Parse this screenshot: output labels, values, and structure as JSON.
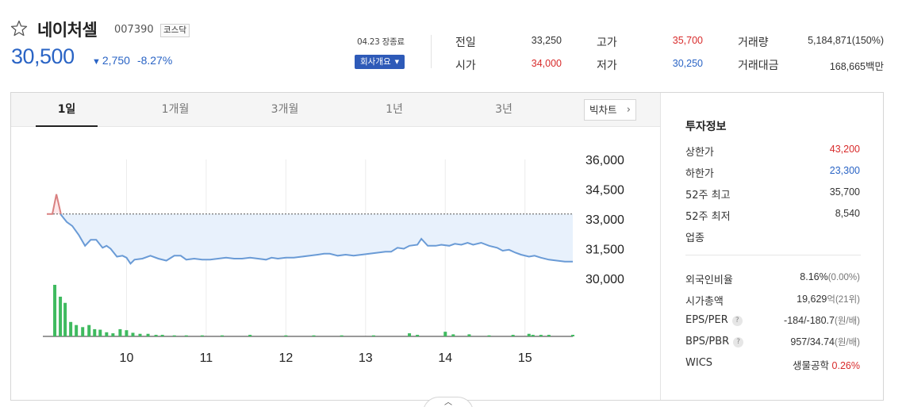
{
  "header": {
    "name": "네이처셀",
    "code": "007390",
    "market": "코스닥",
    "price": "30,500",
    "change_arrow": "▼",
    "change": "2,750",
    "rate": "-8.27%",
    "time_status": "04.23 장종료",
    "company_button": "회사개요"
  },
  "quote": {
    "prev_close": {
      "label": "전일",
      "value": "33,250"
    },
    "open": {
      "label": "시가",
      "value": "34,000"
    },
    "high": {
      "label": "고가",
      "value": "35,700"
    },
    "low": {
      "label": "저가",
      "value": "30,250"
    },
    "volume": {
      "label": "거래량",
      "value": "5,184,871(150%)"
    },
    "amount": {
      "label": "거래대금",
      "value": "168,665백만"
    }
  },
  "tabs": [
    "1일",
    "1개월",
    "3개월",
    "1년",
    "3년"
  ],
  "active_tab": "1일",
  "bigchart_label": "빅차트",
  "colors": {
    "up": "#d82b2b",
    "down": "#2a64c5",
    "volume": "#3fba5f",
    "line": "#6a9bd6"
  },
  "chart_data": {
    "type": "line",
    "y_ticks": [
      "36,000",
      "34,500",
      "33,000",
      "31,500",
      "30,000"
    ],
    "x_ticks": [
      "10",
      "11",
      "12",
      "13",
      "14",
      "15"
    ],
    "ylim": [
      30000,
      36000
    ],
    "baseline": 33250,
    "x_range": [
      9.0,
      15.6
    ],
    "price": [
      [
        9.0,
        33250
      ],
      [
        9.07,
        33250
      ],
      [
        9.12,
        34250
      ],
      [
        9.18,
        33200
      ],
      [
        9.25,
        32850
      ],
      [
        9.32,
        32650
      ],
      [
        9.4,
        32200
      ],
      [
        9.48,
        31650
      ],
      [
        9.55,
        31950
      ],
      [
        9.62,
        31950
      ],
      [
        9.7,
        31550
      ],
      [
        9.75,
        31650
      ],
      [
        9.8,
        31500
      ],
      [
        9.88,
        31100
      ],
      [
        9.95,
        31150
      ],
      [
        10.0,
        31050
      ],
      [
        10.05,
        30750
      ],
      [
        10.1,
        30950
      ],
      [
        10.2,
        31000
      ],
      [
        10.3,
        31150
      ],
      [
        10.4,
        31000
      ],
      [
        10.5,
        30900
      ],
      [
        10.6,
        31150
      ],
      [
        10.68,
        31150
      ],
      [
        10.75,
        30950
      ],
      [
        10.85,
        31000
      ],
      [
        10.95,
        30950
      ],
      [
        11.05,
        30950
      ],
      [
        11.15,
        31000
      ],
      [
        11.25,
        31050
      ],
      [
        11.35,
        31000
      ],
      [
        11.45,
        31000
      ],
      [
        11.55,
        31050
      ],
      [
        11.65,
        31000
      ],
      [
        11.75,
        30950
      ],
      [
        11.82,
        31050
      ],
      [
        11.9,
        31000
      ],
      [
        12.0,
        31050
      ],
      [
        12.1,
        31050
      ],
      [
        12.2,
        31100
      ],
      [
        12.3,
        31150
      ],
      [
        12.4,
        31200
      ],
      [
        12.48,
        31250
      ],
      [
        12.55,
        31250
      ],
      [
        12.65,
        31150
      ],
      [
        12.75,
        31200
      ],
      [
        12.85,
        31150
      ],
      [
        12.95,
        31200
      ],
      [
        13.05,
        31250
      ],
      [
        13.15,
        31300
      ],
      [
        13.25,
        31350
      ],
      [
        13.32,
        31350
      ],
      [
        13.4,
        31550
      ],
      [
        13.48,
        31500
      ],
      [
        13.55,
        31650
      ],
      [
        13.65,
        31700
      ],
      [
        13.7,
        32000
      ],
      [
        13.78,
        31650
      ],
      [
        13.88,
        31650
      ],
      [
        13.95,
        31700
      ],
      [
        14.05,
        31650
      ],
      [
        14.12,
        31750
      ],
      [
        14.2,
        31700
      ],
      [
        14.28,
        31800
      ],
      [
        14.35,
        31700
      ],
      [
        14.45,
        31800
      ],
      [
        14.55,
        31650
      ],
      [
        14.65,
        31550
      ],
      [
        14.72,
        31400
      ],
      [
        14.8,
        31450
      ],
      [
        14.88,
        31300
      ],
      [
        14.95,
        31200
      ],
      [
        15.05,
        31100
      ],
      [
        15.12,
        31150
      ],
      [
        15.2,
        31050
      ],
      [
        15.3,
        30950
      ],
      [
        15.4,
        30900
      ],
      [
        15.5,
        30850
      ],
      [
        15.6,
        30850
      ]
    ],
    "volume": [
      [
        9.1,
        100
      ],
      [
        9.17,
        77
      ],
      [
        9.23,
        65
      ],
      [
        9.3,
        28
      ],
      [
        9.37,
        22
      ],
      [
        9.45,
        18
      ],
      [
        9.53,
        22
      ],
      [
        9.6,
        14
      ],
      [
        9.67,
        13
      ],
      [
        9.75,
        8
      ],
      [
        9.83,
        6
      ],
      [
        9.92,
        14
      ],
      [
        10.0,
        12
      ],
      [
        10.08,
        7
      ],
      [
        10.17,
        5
      ],
      [
        10.27,
        5
      ],
      [
        10.37,
        3
      ],
      [
        10.45,
        3
      ],
      [
        10.6,
        2
      ],
      [
        10.75,
        2
      ],
      [
        10.95,
        2
      ],
      [
        11.2,
        2
      ],
      [
        11.55,
        3
      ],
      [
        12.0,
        2
      ],
      [
        12.35,
        2
      ],
      [
        12.7,
        2
      ],
      [
        13.1,
        2
      ],
      [
        13.55,
        6
      ],
      [
        13.65,
        3
      ],
      [
        14.0,
        9
      ],
      [
        14.1,
        4
      ],
      [
        14.3,
        4
      ],
      [
        14.55,
        2
      ],
      [
        14.85,
        3
      ],
      [
        15.05,
        5
      ],
      [
        15.1,
        3
      ],
      [
        15.2,
        3
      ],
      [
        15.3,
        3
      ],
      [
        15.6,
        3
      ]
    ]
  },
  "investment": {
    "title": "투자정보",
    "items": [
      {
        "label": "상한가",
        "value": "43,200",
        "color": "red"
      },
      {
        "label": "하한가",
        "value": "23,300",
        "color": "blue"
      },
      {
        "label": "52주 최고",
        "value": "35,700"
      },
      {
        "label": "52주 최저",
        "value": "8,540"
      },
      {
        "label": "업종",
        "value": ""
      }
    ],
    "items2": [
      {
        "label": "외국인비율",
        "value": "8.16%",
        "sub": "(0.00%)"
      },
      {
        "label": "시가총액",
        "value": "19,629",
        "sub": "억(21위)"
      },
      {
        "label": "EPS/PER",
        "value": "-184/-180.7",
        "sub": "(원/배)",
        "help": true
      },
      {
        "label": "BPS/PBR",
        "value": "957/34.74",
        "sub": "(원/배)",
        "help": true
      },
      {
        "label": "WICS",
        "value": "생물공학",
        "extra": "0.26%"
      }
    ]
  },
  "bottom_handle": "︿"
}
